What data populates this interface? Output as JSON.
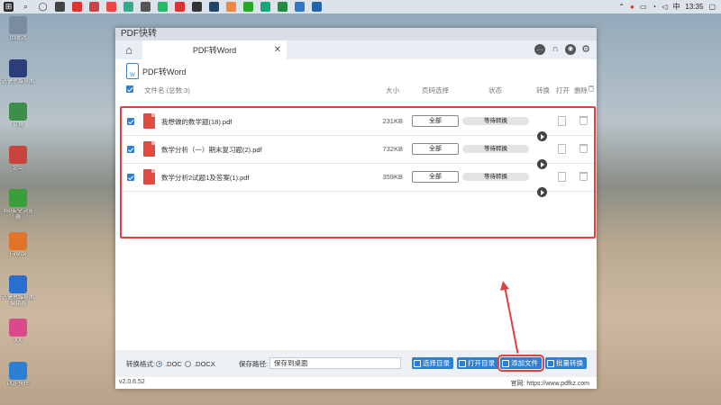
{
  "taskbar": {
    "clock": "13:35",
    "ime": "中",
    "tray_icon_count": 6
  },
  "desktop": {
    "icons": [
      {
        "label": "回收站",
        "icon": "recycle-bin-icon",
        "color": "#7a8ca0"
      },
      {
        "label": "迅捷思维导图",
        "icon": "mindmap-app-icon",
        "color": "#2c3f7a"
      },
      {
        "label": "草稿",
        "icon": "draft-app-icon",
        "color": "#3b8f4a"
      },
      {
        "label": "金山",
        "icon": "kingsoft-icon",
        "color": "#c9443a"
      },
      {
        "label": "360安全浏览器",
        "icon": "browser-360-icon",
        "color": "#3a9f3a"
      },
      {
        "label": "Firefox",
        "icon": "firefox-icon",
        "color": "#e2742a"
      },
      {
        "label": "迅捷思维导图编辑器",
        "icon": "mindmap-editor-icon",
        "color": "#2a6fd0"
      },
      {
        "label": "XX",
        "icon": "document-icon",
        "color": "#d94a8a"
      },
      {
        "label": "PDF快转",
        "icon": "pdf-converter-icon",
        "color": "#2d7fd3"
      }
    ]
  },
  "window": {
    "title": "PDF快转",
    "tab_label": "PDF转Word",
    "subtitle": "PDF转Word",
    "columns": {
      "name": "文件名 (总数:3)",
      "size": "大小",
      "pages": "页码选择",
      "status": "状态",
      "convert": "转换",
      "open": "打开",
      "delete": "删除"
    },
    "files": [
      {
        "name": "我想做的数学题(18).pdf",
        "size": "231KB",
        "pages": "全部",
        "status": "等待转换"
      },
      {
        "name": "数学分析（一）期末复习题(2).pdf",
        "size": "732KB",
        "pages": "全部",
        "status": "等待转换"
      },
      {
        "name": "数学分析2试题1及答案(1).pdf",
        "size": "359KB",
        "pages": "全部",
        "status": "等待转换"
      }
    ],
    "footer": {
      "format_label": "转换格式:",
      "format_doc": ".DOC",
      "format_docx": ".DOCX",
      "selected_format": ".DOC",
      "path_label": "保存路径:",
      "path_value": "保存到桌面",
      "btn_choose_dir": "选择目录",
      "btn_open_dir": "打开目录",
      "btn_add_file": "添加文件",
      "btn_batch_convert": "批量转换"
    },
    "version": "v2.0.6.52",
    "website": "官网: https://www.pdfkz.com"
  },
  "colors": {
    "accent": "#2d7fd3",
    "highlight": "#e0403e",
    "pdf_red": "#e24a3f"
  }
}
